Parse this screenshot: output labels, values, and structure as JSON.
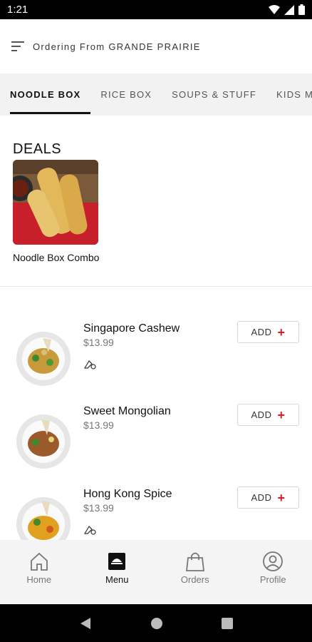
{
  "status_bar": {
    "time": "1:21"
  },
  "header": {
    "title": "Ordering From GRANDE PRAIRIE"
  },
  "tabs": [
    {
      "label": "NOODLE BOX",
      "active": true
    },
    {
      "label": "RICE BOX"
    },
    {
      "label": "SOUPS & STUFF"
    },
    {
      "label": "KIDS ME"
    }
  ],
  "deals": {
    "title": "DEALS",
    "items": [
      {
        "name": "Noodle Box Combo"
      }
    ]
  },
  "menu_items": [
    {
      "name": "Singapore Cashew",
      "price": "$13.99",
      "add_label": "ADD",
      "plus": "+"
    },
    {
      "name": "Sweet Mongolian",
      "price": "$13.99",
      "add_label": "ADD",
      "plus": "+"
    },
    {
      "name": "Hong Kong Spice",
      "price": "$13.99",
      "add_label": "ADD",
      "plus": "+"
    }
  ],
  "bottom_nav": [
    {
      "label": "Home",
      "icon": "home-icon"
    },
    {
      "label": "Menu",
      "icon": "menu-icon",
      "active": true
    },
    {
      "label": "Orders",
      "icon": "bag-icon"
    },
    {
      "label": "Profile",
      "icon": "profile-icon"
    }
  ],
  "colors": {
    "accent": "#e01b24",
    "tab_bar": "#f2f2f2",
    "nav_bar": "#f4f4f4"
  }
}
